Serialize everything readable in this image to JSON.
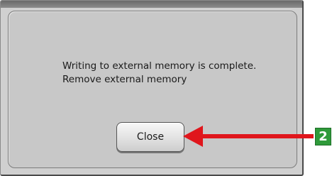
{
  "dialog": {
    "message_line_1": "Writing to external memory is complete.",
    "message_line_2": "Remove external memory",
    "close_label": "Close"
  },
  "callout": {
    "step_number": "2",
    "arrow_color": "#e0161c",
    "badge_color": "#2f9a3a"
  }
}
